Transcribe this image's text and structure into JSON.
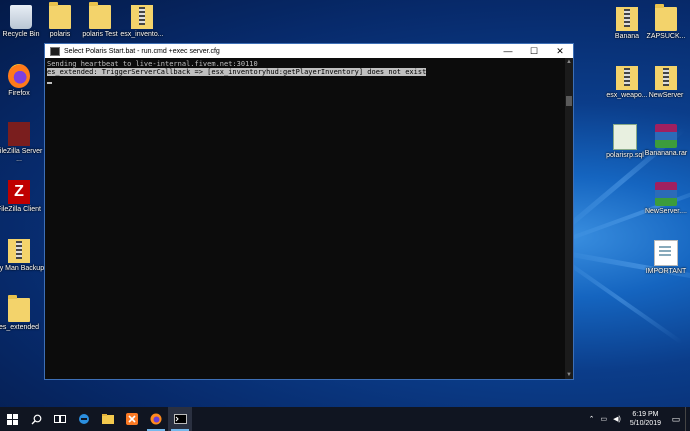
{
  "desktop": {
    "left_icons": [
      {
        "label": "Recycle Bin",
        "icon": "recycle-bin-icon"
      },
      {
        "label": "polaris",
        "icon": "folder-icon"
      },
      {
        "label": "polaris Test",
        "icon": "folder-icon"
      },
      {
        "label": "esx_invento...",
        "icon": "zip-folder-icon"
      },
      {
        "label": "Firefox",
        "icon": "firefox-icon"
      },
      {
        "label": "FileZilla Server ...",
        "icon": "filezilla-server-icon"
      },
      {
        "label": "FileZilla Client",
        "icon": "filezilla-client-icon"
      },
      {
        "label": "My Man Backup",
        "icon": "zip-folder-icon"
      },
      {
        "label": "es_extended",
        "icon": "folder-icon"
      }
    ],
    "right_icons": [
      {
        "label": "Banana",
        "icon": "zip-folder-icon"
      },
      {
        "label": "ZAPSUCK...",
        "icon": "folder-icon"
      },
      {
        "label": "esx_weapo...",
        "icon": "zip-folder-icon"
      },
      {
        "label": "NewServer",
        "icon": "zip-folder-icon"
      },
      {
        "label": "polarisrp.sql",
        "icon": "sql-file-icon"
      },
      {
        "label": "Bananana.rar",
        "icon": "winrar-icon"
      },
      {
        "label": "NewServer....",
        "icon": "winrar-icon"
      },
      {
        "label": "IMPORTANT",
        "icon": "text-document-icon"
      }
    ]
  },
  "window": {
    "title": "Select Polaris Start.bat - run.cmd  +exec server.cfg",
    "minimize": "—",
    "maximize": "☐",
    "close": "✕",
    "lines": [
      "Sending heartbeat to live-internal.fivem.net:30110",
      "es_extended: TriggerServerCallback => [esx_inventoryhud:getPlayerInventory] does not exist"
    ]
  },
  "taskbar": {
    "time": "6:19 PM",
    "date": "5/10/2019",
    "buttons": [
      "start-icon",
      "search-icon",
      "task-view-icon",
      "edge-icon",
      "file-explorer-icon",
      "xampp-icon",
      "firefox-icon",
      "cmd-icon"
    ]
  },
  "colors": {
    "console_bg": "#0c0c0c",
    "console_text": "#c0c0c0",
    "taskbar": "#101521",
    "accent": "#76b9ed"
  }
}
